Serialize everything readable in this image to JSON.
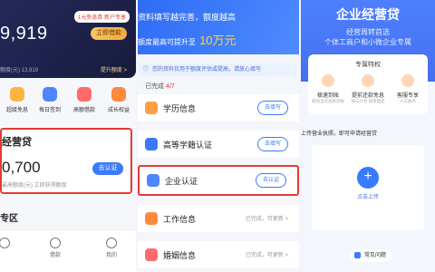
{
  "panel1": {
    "tag_text": "1元免息券 新户专享",
    "amount": "9,919",
    "borrow_label": "立即借款",
    "credit_line": "额度(元) 13,919",
    "raise_label": "提升额度 >",
    "quick_items": [
      {
        "label": "超级免息"
      },
      {
        "label": "每日签到"
      },
      {
        "label": "高额借款"
      },
      {
        "label": "成长权益"
      }
    ],
    "loan": {
      "title": "经营贷",
      "amount": "0,700",
      "sub": "最高额度(元) 立即获得额度",
      "apply_label": "去认证"
    },
    "section2_title": "专区",
    "tabs": [
      {
        "label": ""
      },
      {
        "label": "借款"
      },
      {
        "label": "我的"
      }
    ]
  },
  "panel2": {
    "banner_line1": "资料填写越完善，额度越高",
    "banner_line2_prefix": "额度最高可提升至",
    "banner_line2_big": "10万元",
    "notice": "您的资料仅用于额度评估或提高，请放心填写",
    "done_prefix": "已完成",
    "done_count": "4/7",
    "rows": [
      {
        "label": "学历信息",
        "action": "去填写",
        "type": "button"
      },
      {
        "label": "高等学籍认证",
        "action": "去填写",
        "type": "button"
      },
      {
        "label": "企业认证",
        "action": "去认证",
        "type": "button"
      },
      {
        "label": "工作信息",
        "action": "已完成，可更新 >",
        "type": "text"
      },
      {
        "label": "婚姻信息",
        "action": "已完成，可更新 >",
        "type": "text"
      }
    ]
  },
  "panel3": {
    "title": "企业经营贷",
    "subtitle_line1": "经营周转首选",
    "subtitle_line2": "个体工商户和小微企业专属",
    "privileges_title": "专属特权",
    "privileges": [
      {
        "label": "极速到账",
        "sub": "最快当日放款到账"
      },
      {
        "label": "提前还款免息",
        "sub": "按日计息 随借随还"
      },
      {
        "label": "客服专享",
        "sub": "人工服务"
      }
    ],
    "upload_tip": "上传营业执照，即可申请经营贷",
    "upload_label": "点击上传",
    "faq_label": "常见问题"
  }
}
